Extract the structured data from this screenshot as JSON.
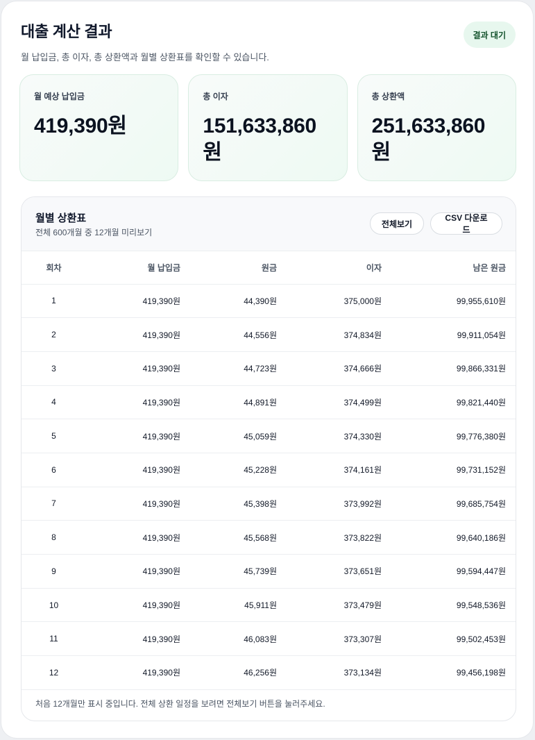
{
  "header": {
    "title": "대출 계산 결과",
    "subtitle": "월 납입금, 총 이자, 총 상환액과 월별 상환표를 확인할 수 있습니다.",
    "status_label": "결과 대기"
  },
  "summary": [
    {
      "label": "월 예상 납입금",
      "value": "419,390원"
    },
    {
      "label": "총 이자",
      "value": "151,633,860원"
    },
    {
      "label": "총 상환액",
      "value": "251,633,860원"
    }
  ],
  "schedule": {
    "title": "월별 상환표",
    "subtitle": "전체 600개월 중 12개월 미리보기",
    "view_all_label": "전체보기",
    "csv_label": "CSV 다운로드",
    "columns": [
      "회차",
      "월 납입금",
      "원금",
      "이자",
      "남은 원금"
    ],
    "rows": [
      [
        "1",
        "419,390원",
        "44,390원",
        "375,000원",
        "99,955,610원"
      ],
      [
        "2",
        "419,390원",
        "44,556원",
        "374,834원",
        "99,911,054원"
      ],
      [
        "3",
        "419,390원",
        "44,723원",
        "374,666원",
        "99,866,331원"
      ],
      [
        "4",
        "419,390원",
        "44,891원",
        "374,499원",
        "99,821,440원"
      ],
      [
        "5",
        "419,390원",
        "45,059원",
        "374,330원",
        "99,776,380원"
      ],
      [
        "6",
        "419,390원",
        "45,228원",
        "374,161원",
        "99,731,152원"
      ],
      [
        "7",
        "419,390원",
        "45,398원",
        "373,992원",
        "99,685,754원"
      ],
      [
        "8",
        "419,390원",
        "45,568원",
        "373,822원",
        "99,640,186원"
      ],
      [
        "9",
        "419,390원",
        "45,739원",
        "373,651원",
        "99,594,447원"
      ],
      [
        "10",
        "419,390원",
        "45,911원",
        "373,479원",
        "99,548,536원"
      ],
      [
        "11",
        "419,390원",
        "46,083원",
        "373,307원",
        "99,502,453원"
      ],
      [
        "12",
        "419,390원",
        "46,256원",
        "373,134원",
        "99,456,198원"
      ]
    ],
    "footer_note": "처음 12개월만 표시 중입니다. 전체 상환 일정을 보려면 전체보기 버튼을 눌러주세요."
  },
  "colors": {
    "accent_bg": "#e7f7ee",
    "accent_text": "#14532d",
    "card_tint": "#eefaf3"
  }
}
